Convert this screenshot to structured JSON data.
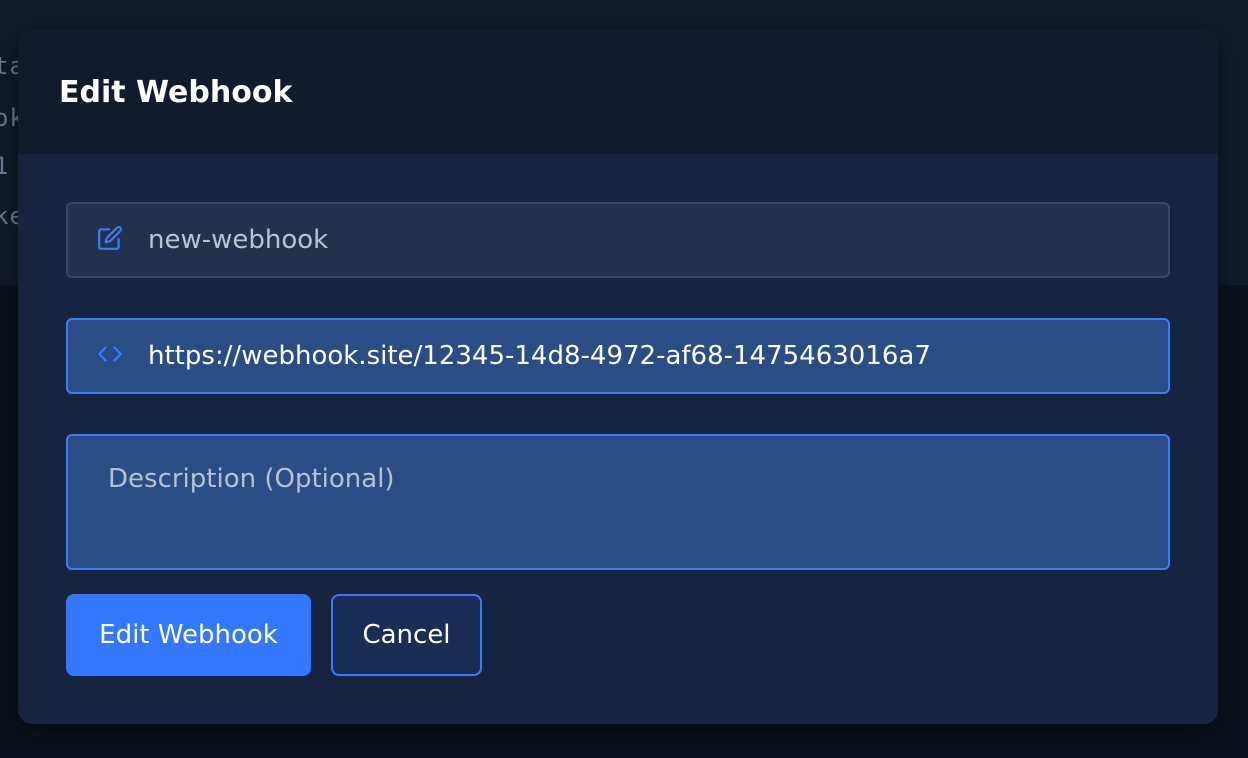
{
  "background": {
    "partial_text_lines": [
      "ta",
      "ok",
      "1",
      "ke"
    ]
  },
  "modal": {
    "title": "Edit Webhook",
    "name_field": {
      "icon": "edit-icon",
      "value": "new-webhook"
    },
    "url_field": {
      "icon": "code-icon",
      "value": "https://webhook.site/12345-14d8-4972-af68-1475463016a7"
    },
    "description_field": {
      "placeholder": "Description (Optional)",
      "value": ""
    },
    "buttons": {
      "submit_label": "Edit Webhook",
      "cancel_label": "Cancel"
    }
  },
  "colors": {
    "accent": "#3378ff",
    "modal_background": "#162440",
    "header_background": "#101b2d"
  }
}
